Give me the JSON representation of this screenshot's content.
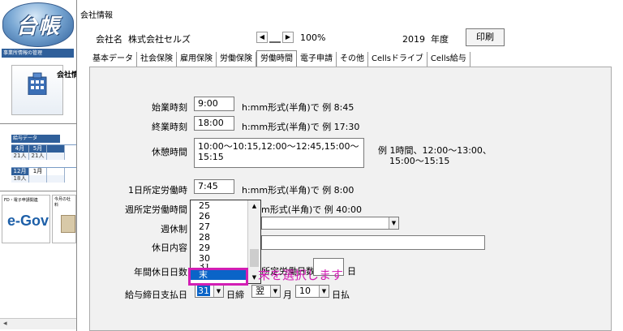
{
  "sidebar": {
    "logo_text": "台帳",
    "office_header": "事業所情報の管理",
    "company_button_label": "会社情報",
    "pay_header": "給与データ",
    "calendar_rows": [
      {
        "top": [
          "4月",
          "5月",
          ""
        ],
        "bottom": [
          "21人",
          "21人",
          ""
        ]
      },
      {
        "top": [
          "12月",
          "1月",
          ""
        ],
        "bottom": [
          "18人",
          "",
          ""
        ]
      }
    ],
    "egov_caption": "FD・電子申請関連",
    "egov_logo": "e-Gov",
    "month_caption": "今月の社料"
  },
  "window": {
    "title": "会社情報"
  },
  "header": {
    "company_label": "会社名",
    "company_name": "株式会社セルズ",
    "zoom": "100%",
    "year": "2019",
    "year_unit": "年度",
    "print_label": "印刷"
  },
  "tabs": [
    {
      "label": "基本データ",
      "active": false
    },
    {
      "label": "社会保険",
      "active": false
    },
    {
      "label": "雇用保険",
      "active": false
    },
    {
      "label": "労働保険",
      "active": false
    },
    {
      "label": "労働時間",
      "active": true
    },
    {
      "label": "電子申請",
      "active": false
    },
    {
      "label": "その他",
      "active": false
    },
    {
      "label": "Cellsドライブ",
      "active": false
    },
    {
      "label": "Cells給与",
      "active": false
    }
  ],
  "form": {
    "start_label": "始業時刻",
    "start_value": "9:00",
    "start_hint": "h:mm形式(半角)で 例 8:45",
    "end_label": "終業時刻",
    "end_value": "18:00",
    "end_hint": "h:mm形式(半角)で 例 17:30",
    "break_label": "休憩時間",
    "break_value_line1": "10:00～10:15,12:00～12:45,15:00～",
    "break_value_line2": "15:15",
    "break_hint_line1": "例 1時間、12:00～13:00、",
    "break_hint_line2": "15:00～15:15",
    "daily_label": "1日所定労働時",
    "daily_value": "7:45",
    "daily_hint": "h:mm形式(半角)で 例 8:00",
    "weekly_label": "週所定労働時間",
    "weekly_hint": "m形式(半角)で 例 40:00",
    "weekly_off_label": "週休制",
    "holiday_label": "休日内容",
    "annual_label": "年間休日日数",
    "annual_hint": "所定労働日数",
    "annual_unit": "日",
    "pay_label": "給与締日支払日",
    "closing_value": "31",
    "closing_unit": "日締",
    "pay_month_value": "翌",
    "pay_month_unit": "月",
    "pay_day_value": "10",
    "pay_day_unit": "日払"
  },
  "dropdown": {
    "items": [
      "25",
      "26",
      "27",
      "28",
      "29",
      "30",
      "31",
      "末"
    ],
    "selected": "末"
  },
  "annotation": {
    "text": "末を選択します"
  }
}
